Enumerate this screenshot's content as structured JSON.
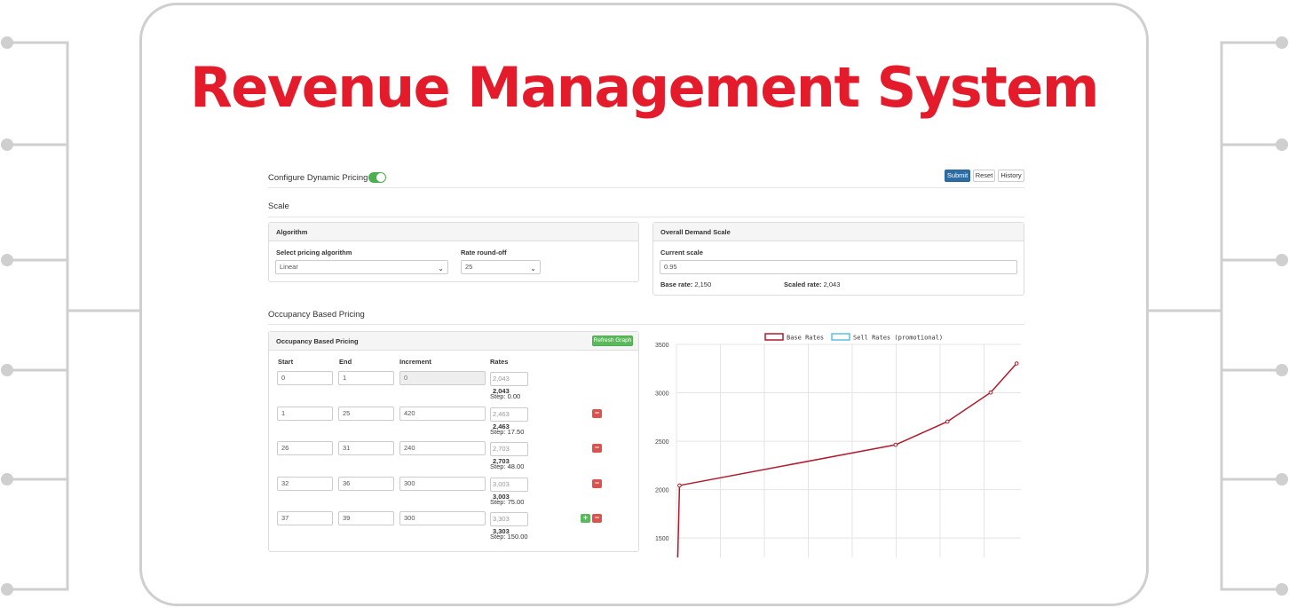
{
  "page": {
    "title": "Revenue Management System"
  },
  "header": {
    "config_label": "Configure Dynamic Pricing",
    "toggle_on": true,
    "submit_label": "Submit",
    "reset_label": "Reset",
    "history_label": "History"
  },
  "scale_section": {
    "title": "Scale"
  },
  "algorithm_panel": {
    "heading": "Algorithm",
    "algorithm_label": "Select pricing algorithm",
    "algorithm_value": "Linear",
    "roundoff_label": "Rate round-off",
    "roundoff_value": "25"
  },
  "demand_panel": {
    "heading": "Overall Demand Scale",
    "current_scale_label": "Current scale",
    "current_scale_value": "0.95",
    "base_rate_label": "Base rate:",
    "base_rate_value": "2,150",
    "scaled_rate_label": "Scaled rate:",
    "scaled_rate_value": "2,043"
  },
  "occupancy_section": {
    "title": "Occupancy Based Pricing"
  },
  "occupancy_panel": {
    "heading": "Occupancy Based Pricing",
    "refresh_label": "Refresh Graph",
    "columns": [
      "Start",
      "End",
      "Increment",
      "Rates"
    ],
    "rows": [
      {
        "start": "0",
        "end": "1",
        "increment": "0",
        "rate_old": "2,043",
        "rate_new": "2,043",
        "step": "Step: 0.00"
      },
      {
        "start": "1",
        "end": "25",
        "increment": "420",
        "rate_old": "2,463",
        "rate_new": "2,463",
        "step": "Step: 17.50"
      },
      {
        "start": "26",
        "end": "31",
        "increment": "240",
        "rate_old": "2,703",
        "rate_new": "2,703",
        "step": "Step: 48.00"
      },
      {
        "start": "32",
        "end": "36",
        "increment": "300",
        "rate_old": "3,003",
        "rate_new": "3,003",
        "step": "Step: 75.00"
      },
      {
        "start": "37",
        "end": "39",
        "increment": "300",
        "rate_old": "3,303",
        "rate_new": "3,303",
        "step": "Step: 150.00"
      }
    ]
  },
  "chart_data": {
    "type": "line",
    "title": "",
    "xlabel": "",
    "ylabel": "",
    "legend": [
      {
        "name": "Base Rates",
        "color": "#b2182b"
      },
      {
        "name": "Sell Rates (promotional)",
        "color": "#5bc0de"
      }
    ],
    "legend_position": "top",
    "ylim": [
      1300,
      3500
    ],
    "yticks": [
      1500,
      2000,
      2500,
      3000,
      3500
    ],
    "grid": true,
    "series": [
      {
        "name": "Base Rates",
        "x": [
          -0.2,
          0,
          25,
          31,
          36,
          39
        ],
        "y": [
          1200,
          2043,
          2463,
          2703,
          3003,
          3303
        ]
      }
    ],
    "xlim": [
      -0.35,
      39.5
    ]
  },
  "colors": {
    "brand_red": "#e31b2b",
    "primary": "#2e6da4",
    "success": "#5cb85c",
    "danger": "#d9534f",
    "toggle": "#4caf50"
  }
}
